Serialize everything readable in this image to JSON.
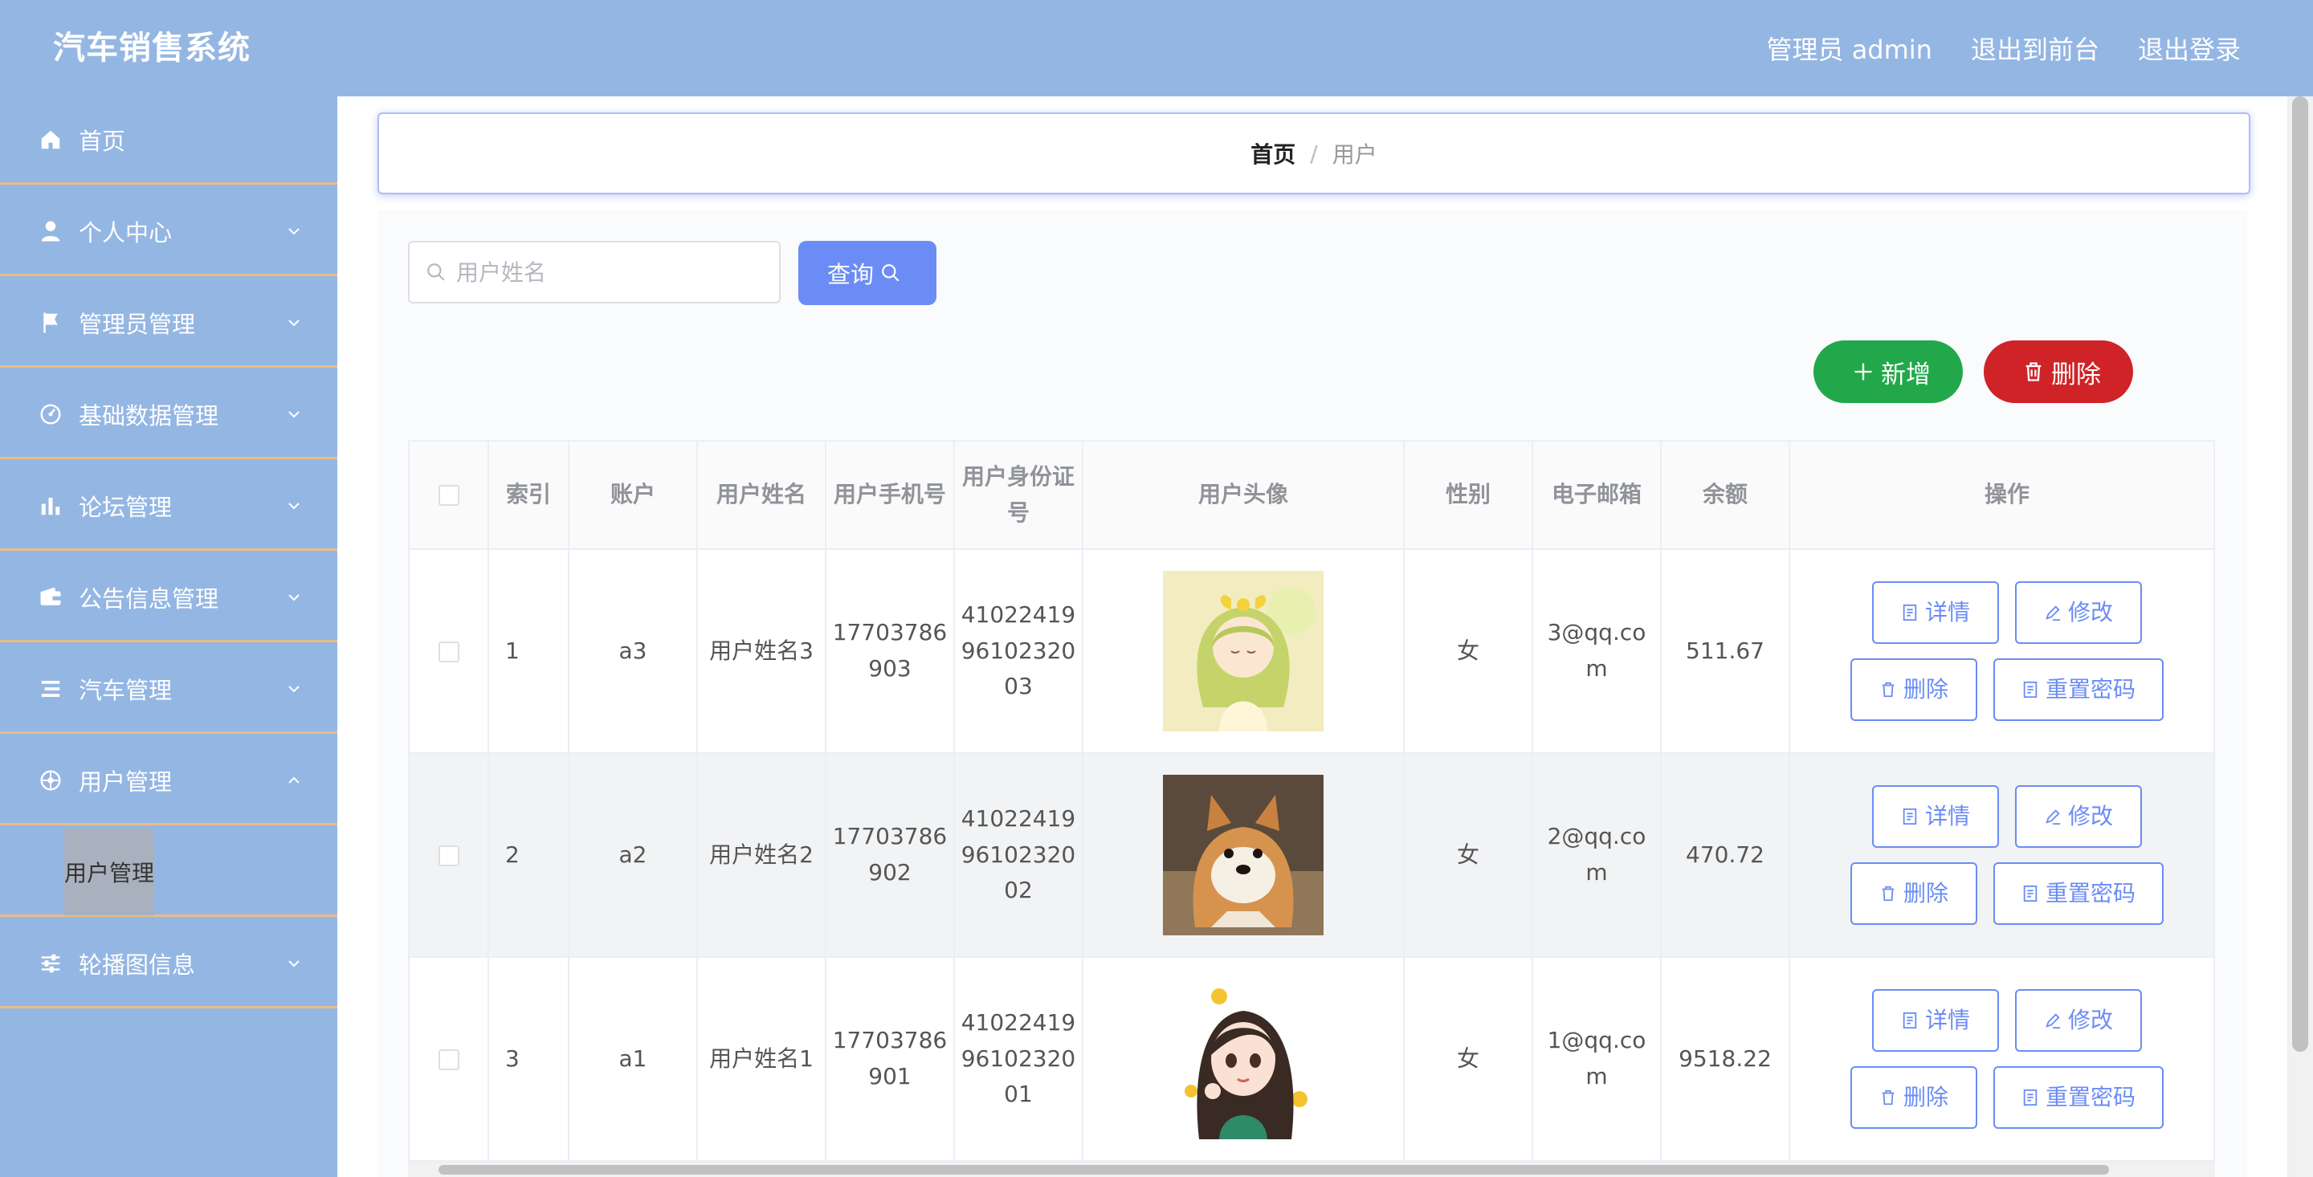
{
  "app": {
    "title": "汽车销售系统"
  },
  "header": {
    "links": [
      "管理员 admin",
      "退出到前台",
      "退出登录"
    ]
  },
  "sidebar": {
    "items": [
      {
        "label": "首页",
        "icon": "home-icon"
      },
      {
        "label": "个人中心",
        "icon": "user-icon"
      },
      {
        "label": "管理员管理",
        "icon": "flag-icon"
      },
      {
        "label": "基础数据管理",
        "icon": "gauge-icon"
      },
      {
        "label": "论坛管理",
        "icon": "bar-chart-icon"
      },
      {
        "label": "公告信息管理",
        "icon": "wallet-icon"
      },
      {
        "label": "汽车管理",
        "icon": "list-icon"
      },
      {
        "label": "用户管理",
        "icon": "compass-icon"
      },
      {
        "label": "轮播图信息",
        "icon": "sliders-icon"
      }
    ],
    "submenu_label": "用户管理"
  },
  "breadcrumb": {
    "home": "首页",
    "separator": "/",
    "current": "用户"
  },
  "search": {
    "placeholder": "用户姓名",
    "value": "",
    "query_label": "查询"
  },
  "actions": {
    "add_label": "新增",
    "delete_label": "删除"
  },
  "table": {
    "headers": [
      "索引",
      "账户",
      "用户姓名",
      "用户手机号",
      "用户身份证号",
      "用户头像",
      "性别",
      "电子邮箱",
      "余额",
      "操作"
    ],
    "rows": [
      {
        "index": "1",
        "account": "a3",
        "name": "用户姓名3",
        "phone": "17703786903",
        "id_card": "410224199610232003",
        "avatar": "anime-girl-yellow-bow",
        "gender": "女",
        "email": "3@qq.com",
        "balance": "511.67"
      },
      {
        "index": "2",
        "account": "a2",
        "name": "用户姓名2",
        "phone": "17703786902",
        "id_card": "410224199610232002",
        "avatar": "shiba-dog",
        "gender": "女",
        "email": "2@qq.com",
        "balance": "470.72"
      },
      {
        "index": "3",
        "account": "a1",
        "name": "用户姓名1",
        "phone": "17703786901",
        "id_card": "410224199610232001",
        "avatar": "cartoon-girl-long-hair",
        "gender": "女",
        "email": "1@qq.com",
        "balance": "9518.22"
      }
    ],
    "row_actions": {
      "detail": "详情",
      "edit": "修改",
      "delete": "删除",
      "reset_password": "重置密码"
    }
  },
  "colors": {
    "header_bg": "#94b6e3",
    "primary": "#6b8cf5",
    "success": "#22a84a",
    "danger": "#cf2328"
  }
}
